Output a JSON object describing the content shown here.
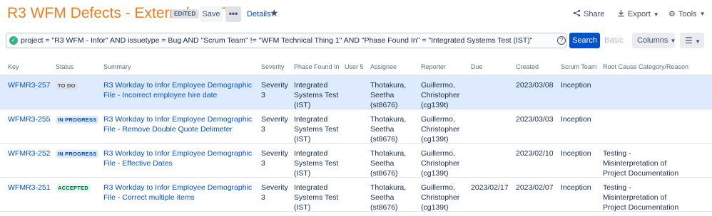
{
  "header": {
    "title": "R3 WFM Defects - External - SIT",
    "edited_badge": "EDITED",
    "save_label": "Save",
    "more_label": "•••",
    "details_label": "Details",
    "share_label": "Share",
    "export_label": "Export",
    "tools_label": "Tools"
  },
  "query": {
    "text": "project = \"R3 WFM - Infor\" AND issuetype = Bug AND \"Scrum Team\" != \"WFM Technical Thing 1\" AND \"Phase Found In\" = \"Integrated Systems Test (IST)\"",
    "search_label": "Search",
    "basic_label": "Basic",
    "columns_label": "Columns"
  },
  "table": {
    "columns": [
      "Key",
      "Status",
      "Summary",
      "Severity",
      "Phase Found In",
      "User 5",
      "Assignee",
      "Reporter",
      "Due",
      "Created",
      "Scrum Team",
      "Root Cause Category/Reason"
    ],
    "rows": [
      {
        "key": "WFMR3-257",
        "status": "TO DO",
        "summary": "R3 Workday to Infor Employee Demographic File - Incorrect employee hire date",
        "severity": "Severity 3",
        "phase": "Integrated Systems Test (IST)",
        "user5": "",
        "assignee": "Thotakura, Seetha (st8676)",
        "reporter": "Guillermo, Christopher (cg139t)",
        "due": "",
        "created": "2023/03/08",
        "scrum": "Inception",
        "root_cause": ""
      },
      {
        "key": "WFMR3-255",
        "status": "IN PROGRESS",
        "summary": "R3 Workday to Infor Employee Demographic File - Remove Double Quote Delimeter",
        "severity": "Severity 3",
        "phase": "Integrated Systems Test (IST)",
        "user5": "",
        "assignee": "Thotakura, Seetha (st8676)",
        "reporter": "Guillermo, Christopher (cg139t)",
        "due": "",
        "created": "2023/03/03",
        "scrum": "Inception",
        "root_cause": ""
      },
      {
        "key": "WFMR3-252",
        "status": "IN PROGRESS",
        "summary": "R3 Workday to Infor Employee Demographic File - Effective Dates",
        "severity": "Severity 3",
        "phase": "Integrated Systems Test (IST)",
        "user5": "",
        "assignee": "Thotakura, Seetha (st8676)",
        "reporter": "Guillermo, Christopher (cg139t)",
        "due": "",
        "created": "2023/02/10",
        "scrum": "Inception",
        "root_cause": "Testing - Misinterpretation of Project Documentation"
      },
      {
        "key": "WFMR3-251",
        "status": "ACCEPTED",
        "summary": "R3 Workday to Infor Employee Demographic File - Correct multiple items",
        "severity": "Severity 3",
        "phase": "Integrated Systems Test (IST)",
        "user5": "",
        "assignee": "Thotakura, Seetha (st8676)",
        "reporter": "Guillermo, Christopher (cg139t)",
        "due": "2023/02/17",
        "created": "2023/02/07",
        "scrum": "Inception",
        "root_cause": "Testing - Misinterpretation of Project Documentation"
      }
    ]
  },
  "colors": {
    "title": "#f07d1c",
    "link": "#0052cc",
    "primary_button": "#0052cc",
    "selected_row": "#deebff",
    "status_ok": "#36b37e"
  },
  "icons": [
    "check-circle-icon",
    "star-icon",
    "share-icon",
    "export-icon",
    "gear-icon",
    "help-icon",
    "hamburger-icon",
    "caret-down-icon"
  ]
}
